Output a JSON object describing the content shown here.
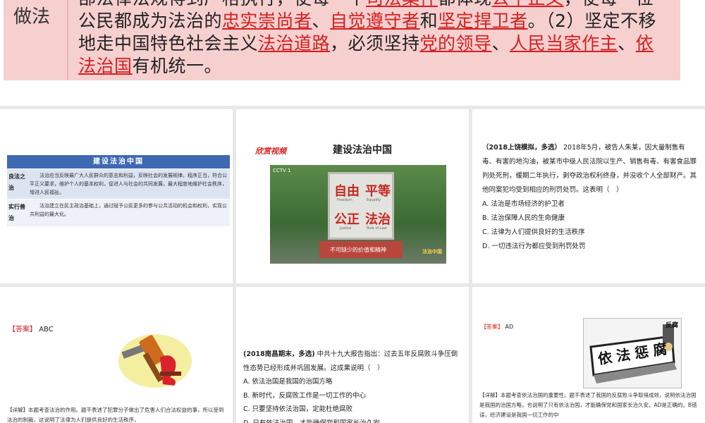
{
  "banner": {
    "label": "做法",
    "segments": [
      {
        "t": "部法律法规得到严格执行，使每一个",
        "red": false
      },
      {
        "t": "司法案件",
        "red": true
      },
      {
        "t": "都体现",
        "red": false
      },
      {
        "t": "公平正义",
        "red": true
      },
      {
        "t": "，使每一位公民都成为法治的",
        "red": false
      },
      {
        "t": "忠实崇尚者",
        "red": true
      },
      {
        "t": "、",
        "red": false
      },
      {
        "t": "自觉遵守者",
        "red": true
      },
      {
        "t": "和",
        "red": false
      },
      {
        "t": "坚定捍卫者",
        "red": true
      },
      {
        "t": "。（2）坚定不移地走中国特色社会主义",
        "red": false
      },
      {
        "t": "法治道路",
        "red": true
      },
      {
        "t": "，必须坚持",
        "red": false
      },
      {
        "t": "党的领导",
        "red": true
      },
      {
        "t": "、",
        "red": false
      },
      {
        "t": "人民当家作主",
        "red": true
      },
      {
        "t": "、",
        "red": false
      },
      {
        "t": "依法治国",
        "red": true
      },
      {
        "t": "有机统一。",
        "red": false
      }
    ]
  },
  "slide1": {
    "table_title": "建设法治中国",
    "rows": [
      {
        "key": "良法之治",
        "value": "法治应当反映最广大人民群众的意志和利益，反映社会的发展规律，程序正当，符合公平正义要求，维护个人的基本权利，促进人与社会的共同发展，最大程度地维护社会秩序，增进人民福祉。"
      },
      {
        "key": "实行善治",
        "value": "法治建立在民主政治基础上，通过赋予公民更多的参与公共活动的机会和权利，实现公共利益的最大化。"
      }
    ]
  },
  "slide2": {
    "tag": "欣赏视频",
    "title": "建设法治中国",
    "sign_words": [
      "自由",
      "平等",
      "公正",
      "法治"
    ],
    "sign_en": [
      "Freedom",
      "Equality",
      "Justice",
      "Rule of Law"
    ],
    "subtitle": "不可缺少的价值和精神",
    "channel": "CCTV 1",
    "corner": "法治中国",
    "base_text": "践行社会主义核心价值观"
  },
  "slide3": {
    "source": "（2018上饶模拟，多选）",
    "stem": "2018年5月，被告人朱某，因大量制售有毒、有害的地沟油，被某市中级人民法院以生产、销售有毒、有害食品罪判处死刑，缓期二年执行，剥夺政治权利终身，并没收个人全部财产。其他同案犯均受到相应的刑罚处罚。这表明（　）",
    "options": [
      "A. 法治是市场经济的护卫者",
      "B. 法治保障人民的生命健康",
      "C. 法律为人们提供良好的生活秩序",
      "D. 一切违法行为都应受到刑罚处罚"
    ]
  },
  "slide4": {
    "answer_key": "【答案】",
    "answer": "ABC",
    "detail": "【详解】本题考查法治的作用。题干表述了犯罪分子做出了危害人们合法权益的事，所以受到法治的制裁，这说明了法律为人们提供良好的生活秩序，"
  },
  "slide5": {
    "source": "(2018南昌期末，多选)",
    "stem": "中共十九大报告指出：过去五年反腐败斗争压倒性态势已经形成并巩固发展。这成果说明（　）",
    "options": [
      "A. 依法治国是我国的治国方略",
      "B. 新时代，反腐败工作是一切工作的中心",
      "C. 只要坚持依法治国，定能杜绝腐败",
      "D. 只有依法治国，才能确保党和国家长治久安"
    ]
  },
  "slide6": {
    "answer_key": "【答案】",
    "answer": "AD",
    "cartoon_words": [
      "依",
      "法",
      "惩",
      "腐"
    ],
    "cartoon_tag": "反腐",
    "detail": "【详解】本题考查依法治国的重要性。题干表述了我国的反腐败斗争取得成效，说明依法治国是我国的治国方略，也说明了只有依法治国，才能确保党和国家长治久安。AD是正确的。B错误，经济建设是我国一切工作的中"
  }
}
